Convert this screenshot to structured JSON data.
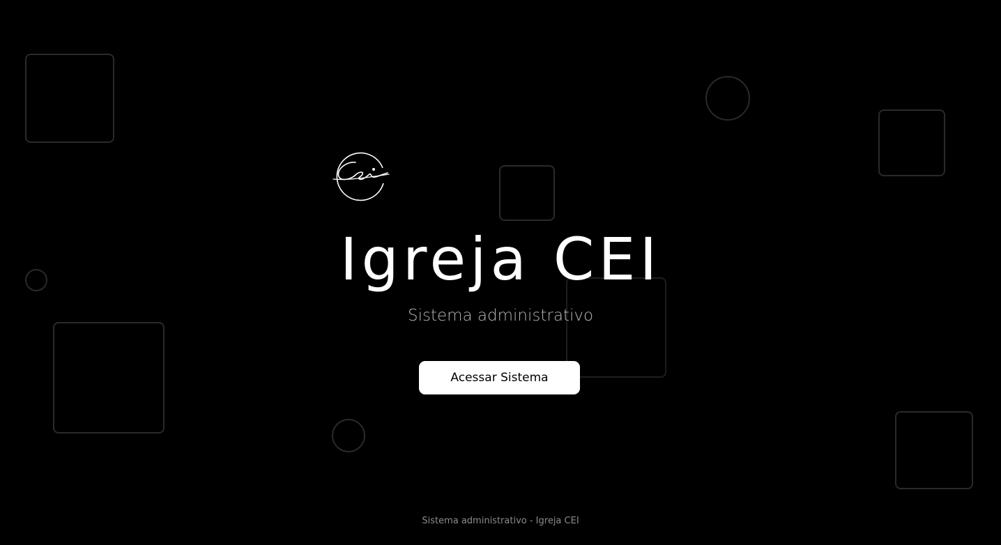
{
  "hero": {
    "title": "Igreja CEI",
    "subtitle": "Sistema administrativo",
    "cta_label": "Acessar Sistema"
  },
  "footer": {
    "text": "Sistema administrativo - Igreja CEI"
  },
  "logo": {
    "icon": "cei-signature-logo"
  },
  "colors": {
    "background": "#000000",
    "title": "#ffffff",
    "subtitle": "#b8b8b8",
    "button_bg": "#ffffff",
    "button_text": "#000000",
    "footer": "#8c8c8c",
    "decor_outline": "#2a2a2a"
  }
}
